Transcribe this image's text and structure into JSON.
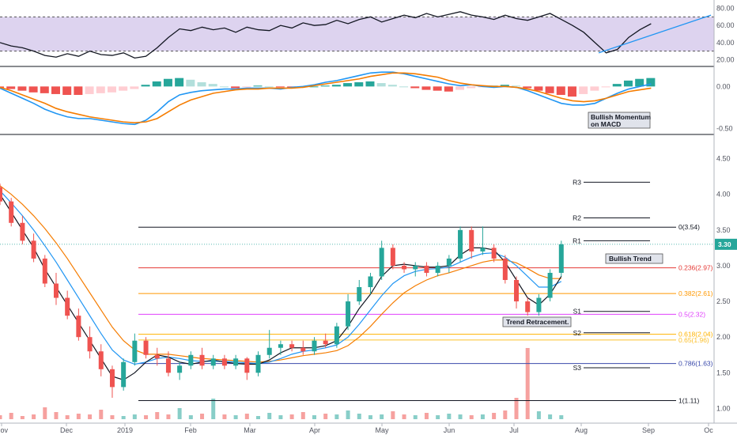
{
  "colors": {
    "up": "#26a69a",
    "down": "#ef5350",
    "sma_fast": "#131722",
    "sma_mid": "#2196f3",
    "sma_slow": "#f57c00",
    "rsi_band": "#d1c4e9",
    "price_badge": "#26a69a"
  },
  "chart_data": [
    {
      "type": "line",
      "panel": "rsi",
      "yticks": [
        "80.00",
        "60.00",
        "40.00",
        "20.00"
      ],
      "ylim": [
        14,
        86
      ],
      "band": [
        30,
        70
      ],
      "x": [
        0,
        3,
        6,
        9,
        12,
        15,
        18,
        21,
        24,
        27,
        30,
        33,
        36,
        39,
        42,
        45,
        48,
        51,
        54,
        57,
        60,
        63,
        66,
        69,
        72,
        75,
        78,
        81,
        84,
        87,
        90,
        93,
        96,
        99,
        102,
        105,
        108,
        111,
        114,
        117,
        120,
        123,
        126,
        129,
        132,
        135,
        138,
        141,
        144,
        147,
        150,
        153,
        156,
        159,
        162,
        165,
        168,
        171,
        174
      ],
      "values": [
        40,
        36,
        34,
        30,
        25,
        23,
        27,
        24,
        30,
        26,
        25,
        28,
        22,
        24,
        34,
        46,
        56,
        54,
        58,
        55,
        57,
        52,
        58,
        55,
        54,
        60,
        57,
        63,
        60,
        61,
        66,
        62,
        67,
        70,
        64,
        68,
        72,
        69,
        74,
        70,
        73,
        76,
        72,
        70,
        67,
        72,
        68,
        66,
        70,
        74,
        67,
        60,
        52,
        40,
        28,
        32,
        46,
        55,
        62
      ],
      "trend_line": {
        "x": [
          160,
          190
        ],
        "y": [
          28,
          72
        ]
      }
    },
    {
      "type": "bar",
      "panel": "macd",
      "yticks": [
        "0.00",
        "-0.50"
      ],
      "ylim": [
        -0.55,
        0.2
      ],
      "x": [
        0,
        3,
        6,
        9,
        12,
        15,
        18,
        21,
        24,
        27,
        30,
        33,
        36,
        39,
        42,
        45,
        48,
        51,
        54,
        57,
        60,
        63,
        66,
        69,
        72,
        75,
        78,
        81,
        84,
        87,
        90,
        93,
        96,
        99,
        102,
        105,
        108,
        111,
        114,
        117,
        120,
        123,
        126,
        129,
        132,
        135,
        138,
        141,
        144,
        147,
        150,
        153,
        156,
        159,
        162,
        165,
        168,
        171,
        174
      ],
      "histogram": [
        -0.02,
        -0.03,
        -0.05,
        -0.07,
        -0.08,
        -0.09,
        -0.1,
        -0.1,
        -0.09,
        -0.08,
        -0.07,
        -0.05,
        -0.03,
        0.02,
        0.06,
        0.09,
        0.1,
        0.08,
        0.05,
        0.03,
        0.0,
        -0.02,
        -0.01,
        0.01,
        0.0,
        -0.01,
        -0.02,
        -0.01,
        0.0,
        0.01,
        0.02,
        0.04,
        0.05,
        0.06,
        0.04,
        0.02,
        0.0,
        -0.02,
        -0.04,
        -0.05,
        -0.06,
        -0.04,
        -0.02,
        -0.01,
        0.01,
        0.02,
        0.01,
        -0.02,
        -0.05,
        -0.08,
        -0.1,
        -0.12,
        -0.09,
        -0.05,
        -0.01,
        0.03,
        0.07,
        0.09,
        0.1
      ],
      "macd": [
        -0.02,
        -0.08,
        -0.14,
        -0.2,
        -0.27,
        -0.32,
        -0.36,
        -0.38,
        -0.38,
        -0.4,
        -0.42,
        -0.44,
        -0.45,
        -0.4,
        -0.3,
        -0.18,
        -0.1,
        -0.07,
        -0.05,
        -0.04,
        -0.03,
        -0.03,
        -0.02,
        -0.02,
        -0.02,
        -0.03,
        -0.01,
        0.0,
        0.02,
        0.05,
        0.07,
        0.1,
        0.13,
        0.16,
        0.17,
        0.17,
        0.15,
        0.12,
        0.09,
        0.06,
        0.03,
        0.01,
        0.02,
        0.0,
        -0.01,
        0.0,
        -0.01,
        -0.05,
        -0.1,
        -0.15,
        -0.2,
        -0.22,
        -0.22,
        -0.2,
        -0.14,
        -0.08,
        -0.03,
        0.0,
        0.03
      ],
      "signal": [
        -0.01,
        -0.05,
        -0.1,
        -0.15,
        -0.2,
        -0.26,
        -0.3,
        -0.33,
        -0.36,
        -0.38,
        -0.4,
        -0.42,
        -0.43,
        -0.42,
        -0.38,
        -0.3,
        -0.22,
        -0.16,
        -0.12,
        -0.08,
        -0.06,
        -0.04,
        -0.03,
        -0.03,
        -0.02,
        -0.02,
        -0.02,
        -0.01,
        0.01,
        0.03,
        0.05,
        0.07,
        0.09,
        0.12,
        0.14,
        0.16,
        0.16,
        0.15,
        0.13,
        0.11,
        0.07,
        0.04,
        0.02,
        0.01,
        0.0,
        0.0,
        -0.01,
        -0.03,
        -0.06,
        -0.1,
        -0.14,
        -0.17,
        -0.18,
        -0.17,
        -0.14,
        -0.1,
        -0.06,
        -0.04,
        -0.02
      ],
      "annotation": "Bullish Momentum on MACD"
    },
    {
      "type": "candlestick",
      "panel": "price",
      "xticks": [
        "Nov",
        "Dec",
        "2019",
        "Feb",
        "Mar",
        "Apr",
        "May",
        "Jun",
        "Jul",
        "Aug",
        "Sep",
        "Oc"
      ],
      "yticks": [
        "4.50",
        "4.00",
        "3.50",
        "3.00",
        "2.50",
        "2.00",
        "1.50",
        "1.00"
      ],
      "ylim": [
        0.85,
        4.75
      ],
      "last_price": "3.30",
      "candles": [
        {
          "x": 0,
          "o": 4.1,
          "h": 4.15,
          "l": 3.85,
          "c": 3.9
        },
        {
          "x": 3,
          "o": 3.9,
          "h": 3.95,
          "l": 3.55,
          "c": 3.6
        },
        {
          "x": 6,
          "o": 3.6,
          "h": 3.7,
          "l": 3.3,
          "c": 3.35
        },
        {
          "x": 9,
          "o": 3.35,
          "h": 3.45,
          "l": 3.05,
          "c": 3.1
        },
        {
          "x": 12,
          "o": 3.1,
          "h": 3.15,
          "l": 2.7,
          "c": 2.75
        },
        {
          "x": 15,
          "o": 2.75,
          "h": 2.9,
          "l": 2.45,
          "c": 2.55
        },
        {
          "x": 18,
          "o": 2.55,
          "h": 2.65,
          "l": 2.25,
          "c": 2.3
        },
        {
          "x": 21,
          "o": 2.3,
          "h": 2.4,
          "l": 1.95,
          "c": 2.0
        },
        {
          "x": 24,
          "o": 2.0,
          "h": 2.15,
          "l": 1.7,
          "c": 1.8
        },
        {
          "x": 27,
          "o": 1.8,
          "h": 1.9,
          "l": 1.45,
          "c": 1.55
        },
        {
          "x": 30,
          "o": 1.55,
          "h": 1.6,
          "l": 1.15,
          "c": 1.3
        },
        {
          "x": 33,
          "o": 1.3,
          "h": 1.7,
          "l": 1.25,
          "c": 1.65
        },
        {
          "x": 36,
          "o": 1.65,
          "h": 2.05,
          "l": 1.6,
          "c": 1.95
        },
        {
          "x": 39,
          "o": 1.95,
          "h": 2.0,
          "l": 1.7,
          "c": 1.75
        },
        {
          "x": 42,
          "o": 1.75,
          "h": 1.85,
          "l": 1.6,
          "c": 1.7
        },
        {
          "x": 45,
          "o": 1.7,
          "h": 1.8,
          "l": 1.45,
          "c": 1.5
        },
        {
          "x": 48,
          "o": 1.5,
          "h": 1.65,
          "l": 1.4,
          "c": 1.6
        },
        {
          "x": 51,
          "o": 1.6,
          "h": 1.8,
          "l": 1.55,
          "c": 1.75
        },
        {
          "x": 54,
          "o": 1.75,
          "h": 1.85,
          "l": 1.55,
          "c": 1.6
        },
        {
          "x": 57,
          "o": 1.6,
          "h": 1.75,
          "l": 1.55,
          "c": 1.7
        },
        {
          "x": 60,
          "o": 1.7,
          "h": 1.75,
          "l": 1.55,
          "c": 1.6
        },
        {
          "x": 63,
          "o": 1.6,
          "h": 1.75,
          "l": 1.55,
          "c": 1.7
        },
        {
          "x": 66,
          "o": 1.7,
          "h": 1.72,
          "l": 1.4,
          "c": 1.5
        },
        {
          "x": 69,
          "o": 1.5,
          "h": 1.8,
          "l": 1.45,
          "c": 1.75
        },
        {
          "x": 72,
          "o": 1.75,
          "h": 2.1,
          "l": 1.7,
          "c": 1.85
        },
        {
          "x": 75,
          "o": 1.85,
          "h": 1.95,
          "l": 1.75,
          "c": 1.9
        },
        {
          "x": 78,
          "o": 1.9,
          "h": 1.95,
          "l": 1.8,
          "c": 1.85
        },
        {
          "x": 81,
          "o": 1.85,
          "h": 1.95,
          "l": 1.75,
          "c": 1.8
        },
        {
          "x": 84,
          "o": 1.8,
          "h": 2.0,
          "l": 1.75,
          "c": 1.95
        },
        {
          "x": 87,
          "o": 1.95,
          "h": 2.05,
          "l": 1.85,
          "c": 1.9
        },
        {
          "x": 90,
          "o": 1.9,
          "h": 2.2,
          "l": 1.85,
          "c": 2.15
        },
        {
          "x": 93,
          "o": 2.15,
          "h": 2.6,
          "l": 2.1,
          "c": 2.5
        },
        {
          "x": 96,
          "o": 2.5,
          "h": 2.8,
          "l": 2.45,
          "c": 2.7
        },
        {
          "x": 99,
          "o": 2.7,
          "h": 2.9,
          "l": 2.6,
          "c": 2.85
        },
        {
          "x": 102,
          "o": 2.85,
          "h": 3.35,
          "l": 2.8,
          "c": 3.25
        },
        {
          "x": 105,
          "o": 3.25,
          "h": 3.3,
          "l": 2.95,
          "c": 3.0
        },
        {
          "x": 108,
          "o": 3.0,
          "h": 3.05,
          "l": 2.9,
          "c": 2.95
        },
        {
          "x": 111,
          "o": 2.95,
          "h": 3.05,
          "l": 2.85,
          "c": 3.0
        },
        {
          "x": 114,
          "o": 3.0,
          "h": 3.05,
          "l": 2.85,
          "c": 2.9
        },
        {
          "x": 117,
          "o": 2.9,
          "h": 3.05,
          "l": 2.85,
          "c": 3.0
        },
        {
          "x": 120,
          "o": 3.0,
          "h": 3.15,
          "l": 2.9,
          "c": 3.1
        },
        {
          "x": 123,
          "o": 3.1,
          "h": 3.55,
          "l": 3.05,
          "c": 3.5
        },
        {
          "x": 126,
          "o": 3.5,
          "h": 3.55,
          "l": 3.1,
          "c": 3.2
        },
        {
          "x": 129,
          "o": 3.2,
          "h": 3.55,
          "l": 3.15,
          "c": 3.25
        },
        {
          "x": 132,
          "o": 3.25,
          "h": 3.3,
          "l": 3.05,
          "c": 3.1
        },
        {
          "x": 135,
          "o": 3.1,
          "h": 3.15,
          "l": 2.75,
          "c": 2.8
        },
        {
          "x": 138,
          "o": 2.8,
          "h": 2.85,
          "l": 2.4,
          "c": 2.5
        },
        {
          "x": 141,
          "o": 2.5,
          "h": 2.55,
          "l": 2.3,
          "c": 2.35
        },
        {
          "x": 144,
          "o": 2.35,
          "h": 2.6,
          "l": 2.3,
          "c": 2.55
        },
        {
          "x": 147,
          "o": 2.55,
          "h": 2.95,
          "l": 2.5,
          "c": 2.9
        },
        {
          "x": 150,
          "o": 2.9,
          "h": 3.35,
          "l": 2.85,
          "c": 3.3
        }
      ],
      "sma_fast": [
        4.0,
        3.75,
        3.5,
        3.25,
        2.95,
        2.7,
        2.45,
        2.2,
        1.95,
        1.7,
        1.45,
        1.4,
        1.5,
        1.65,
        1.75,
        1.72,
        1.65,
        1.62,
        1.65,
        1.68,
        1.65,
        1.63,
        1.62,
        1.62,
        1.68,
        1.78,
        1.85,
        1.85,
        1.85,
        1.88,
        1.95,
        2.15,
        2.4,
        2.6,
        2.85,
        3.0,
        3.02,
        3.0,
        2.98,
        2.98,
        3.0,
        3.15,
        3.25,
        3.25,
        3.22,
        3.05,
        2.8,
        2.55,
        2.45,
        2.6,
        2.85
      ],
      "sma_mid": [
        4.05,
        3.88,
        3.7,
        3.5,
        3.28,
        3.05,
        2.8,
        2.55,
        2.3,
        2.05,
        1.82,
        1.68,
        1.62,
        1.65,
        1.7,
        1.72,
        1.7,
        1.67,
        1.66,
        1.66,
        1.66,
        1.65,
        1.64,
        1.63,
        1.65,
        1.7,
        1.76,
        1.8,
        1.82,
        1.85,
        1.89,
        2.0,
        2.18,
        2.38,
        2.58,
        2.75,
        2.86,
        2.92,
        2.95,
        2.96,
        2.98,
        3.05,
        3.12,
        3.17,
        3.18,
        3.12,
        3.0,
        2.85,
        2.7,
        2.7,
        2.78
      ],
      "sma_slow": [
        4.12,
        4.0,
        3.86,
        3.7,
        3.52,
        3.32,
        3.1,
        2.86,
        2.62,
        2.38,
        2.14,
        1.95,
        1.82,
        1.76,
        1.76,
        1.76,
        1.74,
        1.72,
        1.7,
        1.69,
        1.68,
        1.67,
        1.66,
        1.65,
        1.66,
        1.68,
        1.71,
        1.74,
        1.76,
        1.78,
        1.81,
        1.88,
        2.0,
        2.15,
        2.32,
        2.48,
        2.62,
        2.72,
        2.8,
        2.86,
        2.9,
        2.95,
        3.0,
        3.05,
        3.08,
        3.08,
        3.04,
        2.96,
        2.87,
        2.82,
        2.82
      ],
      "volume": [
        0.5,
        0.8,
        0.4,
        0.6,
        1.5,
        0.9,
        0.5,
        0.7,
        0.6,
        1.2,
        0.5,
        0.4,
        0.6,
        0.5,
        0.9,
        0.6,
        1.4,
        0.5,
        0.7,
        2.6,
        0.6,
        0.5,
        0.7,
        0.4,
        0.8,
        0.5,
        0.6,
        0.9,
        0.5,
        0.7,
        0.6,
        1.1,
        0.7,
        0.5,
        0.6,
        1.0,
        0.6,
        0.5,
        0.8,
        0.5,
        0.7,
        0.6,
        0.5,
        0.6,
        0.8,
        1.1,
        2.7,
        9.0,
        1.0,
        0.6,
        0.5
      ],
      "fib_levels": [
        {
          "label": "0(3.54)",
          "value": 3.54,
          "color": "#131722"
        },
        {
          "label": "0.236(2.97)",
          "value": 2.97,
          "color": "#e53935"
        },
        {
          "label": "0.382(2.61)",
          "value": 2.61,
          "color": "#ff9800"
        },
        {
          "label": "0.5(2.32)",
          "value": 2.32,
          "color": "#e040fb"
        },
        {
          "label": "0.618(2.04)",
          "value": 2.04,
          "color": "#ffb300"
        },
        {
          "label": "0.65(1.96)",
          "value": 1.96,
          "color": "#fbc02d"
        },
        {
          "label": "0.786(1.63)",
          "value": 1.63,
          "color": "#3949ab"
        },
        {
          "label": "1(1.11)",
          "value": 1.11,
          "color": "#131722"
        }
      ],
      "pivots": [
        {
          "label": "R3",
          "value": 4.17
        },
        {
          "label": "R2",
          "value": 3.67
        },
        {
          "label": "R1",
          "value": 3.35
        },
        {
          "label": "S1",
          "value": 2.36
        },
        {
          "label": "S2",
          "value": 2.06
        },
        {
          "label": "S3",
          "value": 1.57
        }
      ],
      "annotations": [
        "Bullish Trend",
        "Trend Retracement."
      ]
    }
  ]
}
